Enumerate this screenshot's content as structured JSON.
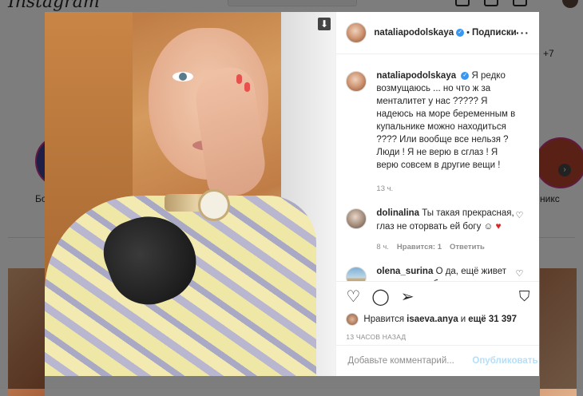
{
  "background": {
    "logo": "Instagram",
    "story_left_label": "Бо",
    "story_right_label": "никс",
    "plus_text": "+7"
  },
  "post": {
    "username": "nataliapodolskaya",
    "follow_label": "Подписки",
    "caption": "Я редко возмущаюсь ... но что ж за менталитет у нас ????? Я надеюсь на море беременным в купальнике можно находиться ???? Или вообще все нельзя ? Люди ! Я не верю в сглаз ! Я верю совсем в другие вещи !",
    "caption_time": "13 ч.",
    "comments": [
      {
        "username": "dolinalina",
        "text": "Ты такая прекрасная, глаз не оторвать ей богу ☺",
        "time": "8 ч.",
        "likes": "Нравится: 1",
        "reply": "Ответить"
      },
      {
        "username": "olena_surina",
        "text": "О да, ещё живет поверье, что беременная женщина типа, больна, прокаженная, должна жрать за двоих и сидеть дома"
      }
    ],
    "likes_prefix": "Нравится",
    "likes_user": "isaeva.anya",
    "likes_suffix": "и",
    "likes_count": "ещё 31 397",
    "timestamp": "13 ЧАСОВ НАЗАД",
    "comment_placeholder": "Добавьте комментарий...",
    "publish_label": "Опубликовать"
  },
  "colors": {
    "accent": "#3897f0",
    "publish_disabled": "#b2dffc",
    "heart": "#e02424"
  }
}
